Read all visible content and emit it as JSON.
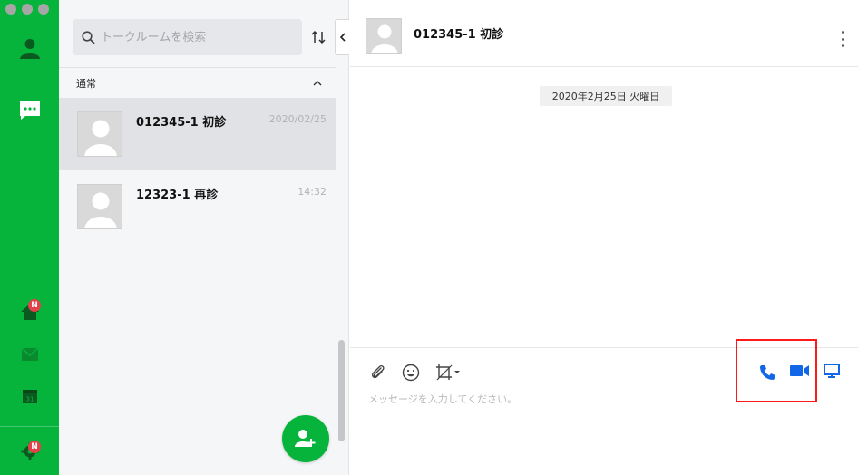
{
  "colors": {
    "brand_green": "#06b43c",
    "call_blue": "#1267e6",
    "highlight_red": "#ff1a1a",
    "badge_red": "#e4414a"
  },
  "rail": {
    "icons": [
      {
        "name": "friends-icon"
      },
      {
        "name": "chats-icon",
        "active": true
      },
      {
        "name": "home-icon",
        "badge": "N"
      },
      {
        "name": "mail-icon"
      },
      {
        "name": "calendar-icon",
        "text": "31"
      },
      {
        "name": "settings-icon",
        "badge": "N"
      }
    ]
  },
  "search": {
    "placeholder": "トークルームを検索"
  },
  "list": {
    "section_label": "通常",
    "rooms": [
      {
        "name": "012345-1 初診",
        "time": "2020/02/25",
        "selected": true
      },
      {
        "name": "12323-1 再診",
        "time": "14:32",
        "selected": false
      }
    ]
  },
  "chat": {
    "title": "012345-1 初診",
    "date_divider": "2020年2月25日 火曜日",
    "input_placeholder": "メッセージを入力してください。"
  }
}
